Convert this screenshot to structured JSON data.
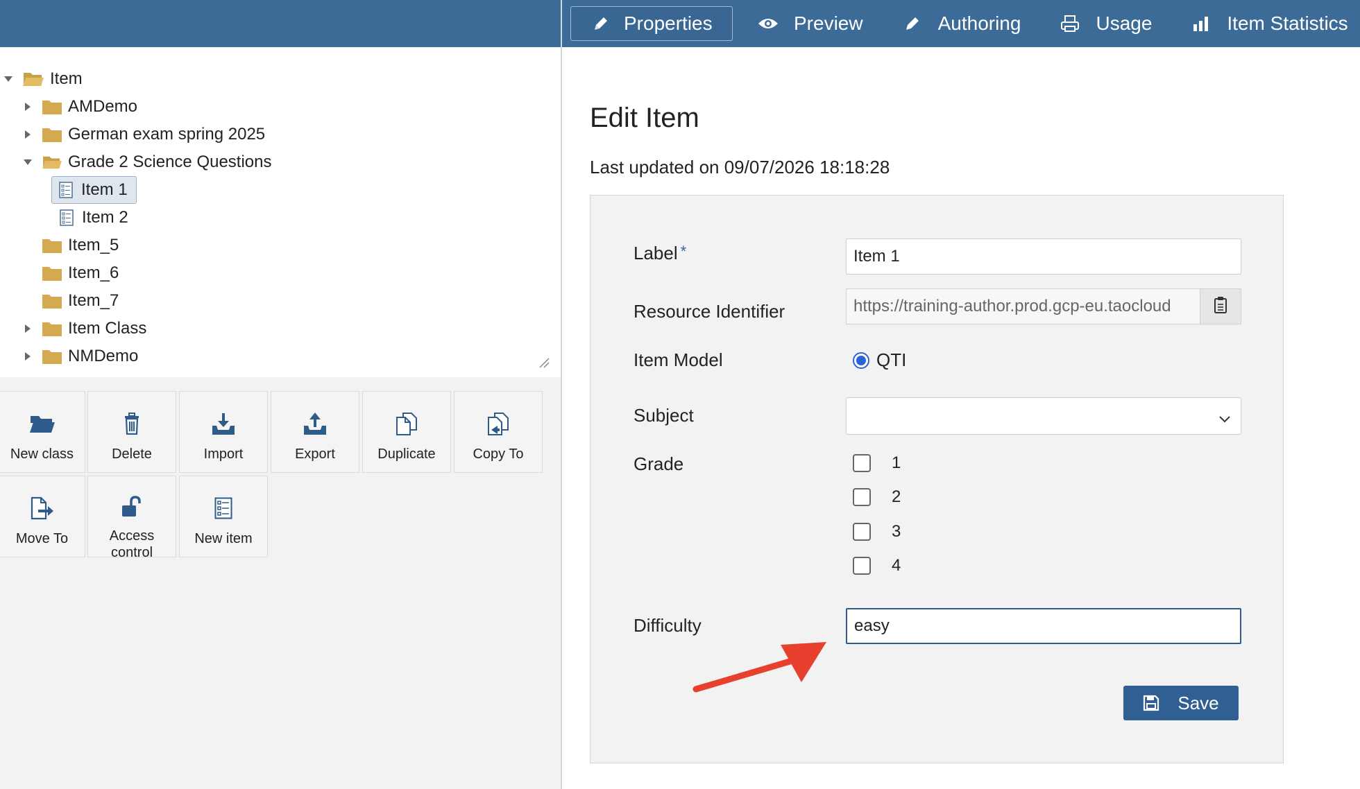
{
  "tabs": [
    {
      "label": "Properties",
      "icon": "pencil-icon",
      "active": true
    },
    {
      "label": "Preview",
      "icon": "eye-icon",
      "active": false
    },
    {
      "label": "Authoring",
      "icon": "pencil-icon",
      "active": false
    },
    {
      "label": "Usage",
      "icon": "printer-icon",
      "active": false
    },
    {
      "label": "Item Statistics",
      "icon": "bar-chart-icon",
      "active": false
    }
  ],
  "tree": {
    "root": "Item",
    "nodes": {
      "amdemo": "AMDemo",
      "german": "German exam spring 2025",
      "grade2": "Grade 2 Science Questions",
      "item1": "Item 1",
      "item2": "Item 2",
      "item5": "Item_5",
      "item6": "Item_6",
      "item7": "Item_7",
      "itemclass": "Item Class",
      "nmdemo": "NMDemo"
    }
  },
  "actions": {
    "new_class": "New class",
    "delete": "Delete",
    "import": "Import",
    "export": "Export",
    "duplicate": "Duplicate",
    "copy_to": "Copy To",
    "move_to": "Move To",
    "access_control": "Access control",
    "new_item": "New item"
  },
  "page": {
    "title": "Edit Item",
    "last_updated": "Last updated on 09/07/2026 18:18:28"
  },
  "form": {
    "label": {
      "label": "Label",
      "required_mark": "*",
      "value": "Item 1"
    },
    "resource_identifier": {
      "label": "Resource Identifier",
      "value": "https://training-author.prod.gcp-eu.taocloud"
    },
    "item_model": {
      "label": "Item Model",
      "option": "QTI"
    },
    "subject": {
      "label": "Subject",
      "value": ""
    },
    "grade": {
      "label": "Grade",
      "options": [
        "1",
        "2",
        "3",
        "4"
      ]
    },
    "difficulty": {
      "label": "Difficulty",
      "value": "easy"
    },
    "save_label": "Save"
  },
  "colors": {
    "header": "#3d6b98",
    "folder": "#d4a94f",
    "save": "#2f5f93",
    "annotation_arrow": "#e8402e"
  }
}
